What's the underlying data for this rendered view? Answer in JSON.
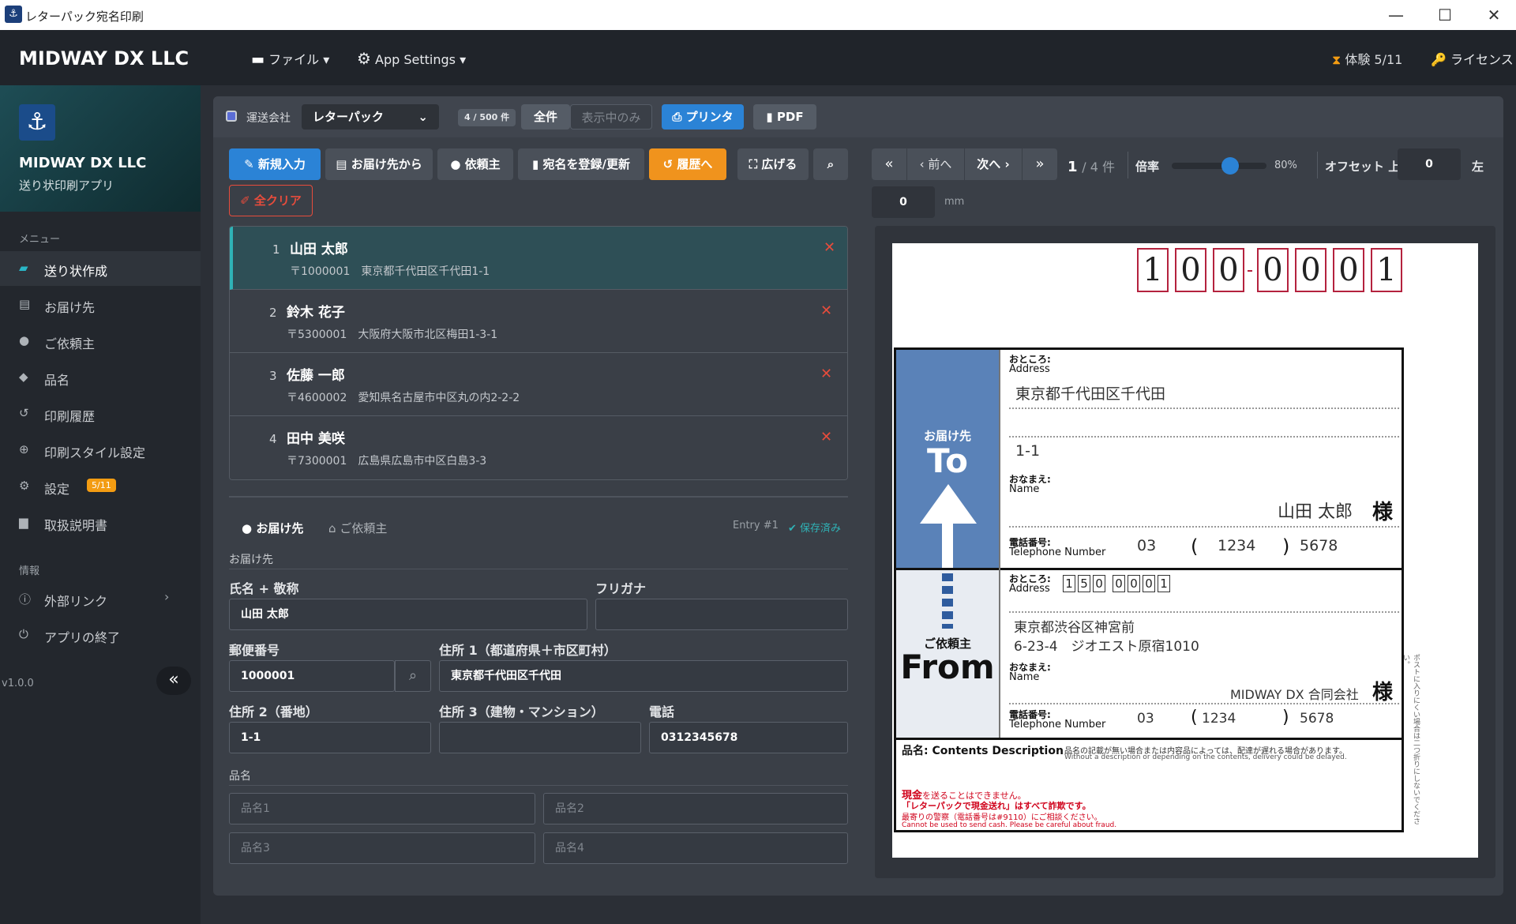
{
  "window": {
    "title": "レターパック宛名印刷",
    "icon": "anchor-icon"
  },
  "topbar": {
    "brand": "MIDWAY DX LLC",
    "file_menu": "ファイル",
    "settings_menu": "App Settings",
    "trial": "体験 5/11",
    "license": "ライセンス"
  },
  "sidebar": {
    "company": "MIDWAY DX LLC",
    "app": "送り状印刷アプリ",
    "menu_header": "メニュー",
    "info_header": "情報",
    "version": "v1.0.0",
    "items": [
      "送り状作成",
      "お届け先",
      "ご依頼主",
      "品名",
      "印刷履歴",
      "印刷スタイル設定",
      "設定",
      "取扱説明書"
    ],
    "settings_badge": "5/11",
    "info_items": [
      "外部リンク",
      "アプリの終了"
    ]
  },
  "toolbar": {
    "carrier_label": "運送会社",
    "carrier_value": "レターパック",
    "count": "4 / 500 件",
    "all": "全件",
    "shown_only": "表示中のみ",
    "printer": "プリンタ",
    "pdf": "PDF"
  },
  "actions": {
    "new": "新規入力",
    "from_dest": "お届け先から",
    "requester": "依頼主",
    "register": "宛名を登録/更新",
    "history": "履歴へ",
    "expand": "広げる",
    "clear": "全クリア"
  },
  "entries": [
    {
      "num": "1",
      "name": "山田 太郎",
      "addr": "〒1000001　東京都千代田区千代田1-1"
    },
    {
      "num": "2",
      "name": "鈴木 花子",
      "addr": "〒5300001　大阪府大阪市北区梅田1-3-1"
    },
    {
      "num": "3",
      "name": "佐藤 一郎",
      "addr": "〒4600002　愛知県名古屋市中区丸の内2-2-2"
    },
    {
      "num": "4",
      "name": "田中 美咲",
      "addr": "〒7300001　広島県広島市中区白島3-3"
    }
  ],
  "form": {
    "tab_dest": "お届け先",
    "tab_req": "ご依頼主",
    "entry_no": "Entry #1",
    "saved": "保存済み",
    "section": "お届け先",
    "name_label": "氏名 + 敬称",
    "name_value": "山田 太郎",
    "kana_label": "フリガナ",
    "kana_value": "",
    "zip_label": "郵便番号",
    "zip_value": "1000001",
    "addr1_label": "住所 1（都道府県＋市区町村）",
    "addr1_value": "東京都千代田区千代田",
    "addr2_label": "住所 2（番地）",
    "addr2_value": "1-1",
    "addr3_label": "住所 3（建物・マンション）",
    "addr3_value": "",
    "tel_label": "電話",
    "tel_value": "0312345678",
    "items_label": "品名",
    "item1": "品名1",
    "item2": "品名2",
    "item3": "品名3",
    "item4": "品名4"
  },
  "preview_nav": {
    "first": "«",
    "prev": "前へ",
    "next": "次へ",
    "last": "»",
    "page": "1",
    "total": "/ 4 件",
    "zoom_label": "倍率",
    "zoom": "80%",
    "zoom_fraction": 0.62,
    "offset_label": "オフセット 上",
    "offset_top": "0",
    "left_label": "左",
    "offset_left": "0",
    "unit": "mm"
  },
  "label": {
    "zip": [
      "1",
      "0",
      "0",
      "0",
      "0",
      "0",
      "1"
    ],
    "to_jp": "お届け先",
    "to_en": "To",
    "from_jp": "ご依頼主",
    "from_en": "From",
    "addr_jp": "おところ:",
    "addr_en": "Address",
    "name_jp": "おなまえ:",
    "name_en": "Name",
    "tel_jp": "電話番号:",
    "tel_en": "Telephone Number",
    "to_addr1": "東京都千代田区千代田",
    "to_addr2": "1-1",
    "to_name": "山田 太郎",
    "sama": "様",
    "to_tel": [
      "03",
      "(",
      "1234",
      ")",
      "5678"
    ],
    "from_zip": [
      "1",
      "5",
      "0",
      "0",
      "0",
      "0",
      "1"
    ],
    "from_addr1": "東京都渋谷区神宮前",
    "from_addr2": "6-23-4　ジオエスト原宿1010",
    "from_name": "MIDWAY DX 合同会社",
    "from_tel": [
      "03",
      "(",
      "1234",
      ")",
      "5678"
    ],
    "contents_title": "品名: Contents Description",
    "contents_note1": "品名の記載が無い場合または内容品によっては、配達が遅れる場合があります。",
    "contents_note2": "Without a description or depending on the contents, delivery could be delayed.",
    "warn1a": "現金",
    "warn1b": "を送ることはできません。",
    "warn2": "「レターパックで現金送れ」はすべて詐欺です。",
    "warn3": "最寄りの警察（電話番号は#9110）にご相談ください。",
    "warn4": "Cannot be used to send cash. Please be careful about fraud.",
    "side_note": "ポストに入りにくい場合は二つ折りにしないでください。"
  }
}
